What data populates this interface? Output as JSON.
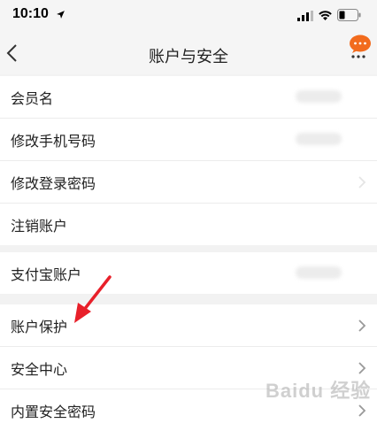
{
  "status_bar": {
    "time": "10:10"
  },
  "nav": {
    "title": "账户与安全"
  },
  "groups": [
    {
      "items": [
        {
          "label": "会员名",
          "has_value": true,
          "has_chevron": false
        },
        {
          "label": "修改手机号码",
          "has_value": true,
          "has_chevron": false
        },
        {
          "label": "修改登录密码",
          "has_value": false,
          "has_chevron": true
        },
        {
          "label": "注销账户",
          "has_value": false,
          "has_chevron": false
        }
      ]
    },
    {
      "items": [
        {
          "label": "支付宝账户",
          "has_value": true,
          "has_chevron": false
        }
      ]
    },
    {
      "items": [
        {
          "label": "账户保护",
          "has_value": false,
          "has_chevron": true
        },
        {
          "label": "安全中心",
          "has_value": false,
          "has_chevron": true
        },
        {
          "label": "内置安全密码",
          "has_value": false,
          "has_chevron": true
        }
      ]
    }
  ],
  "colors": {
    "accent": "#f26b1d",
    "annotation_arrow": "#e8202a",
    "background": "#f2f2f2"
  },
  "watermark": "Baidu 经验"
}
